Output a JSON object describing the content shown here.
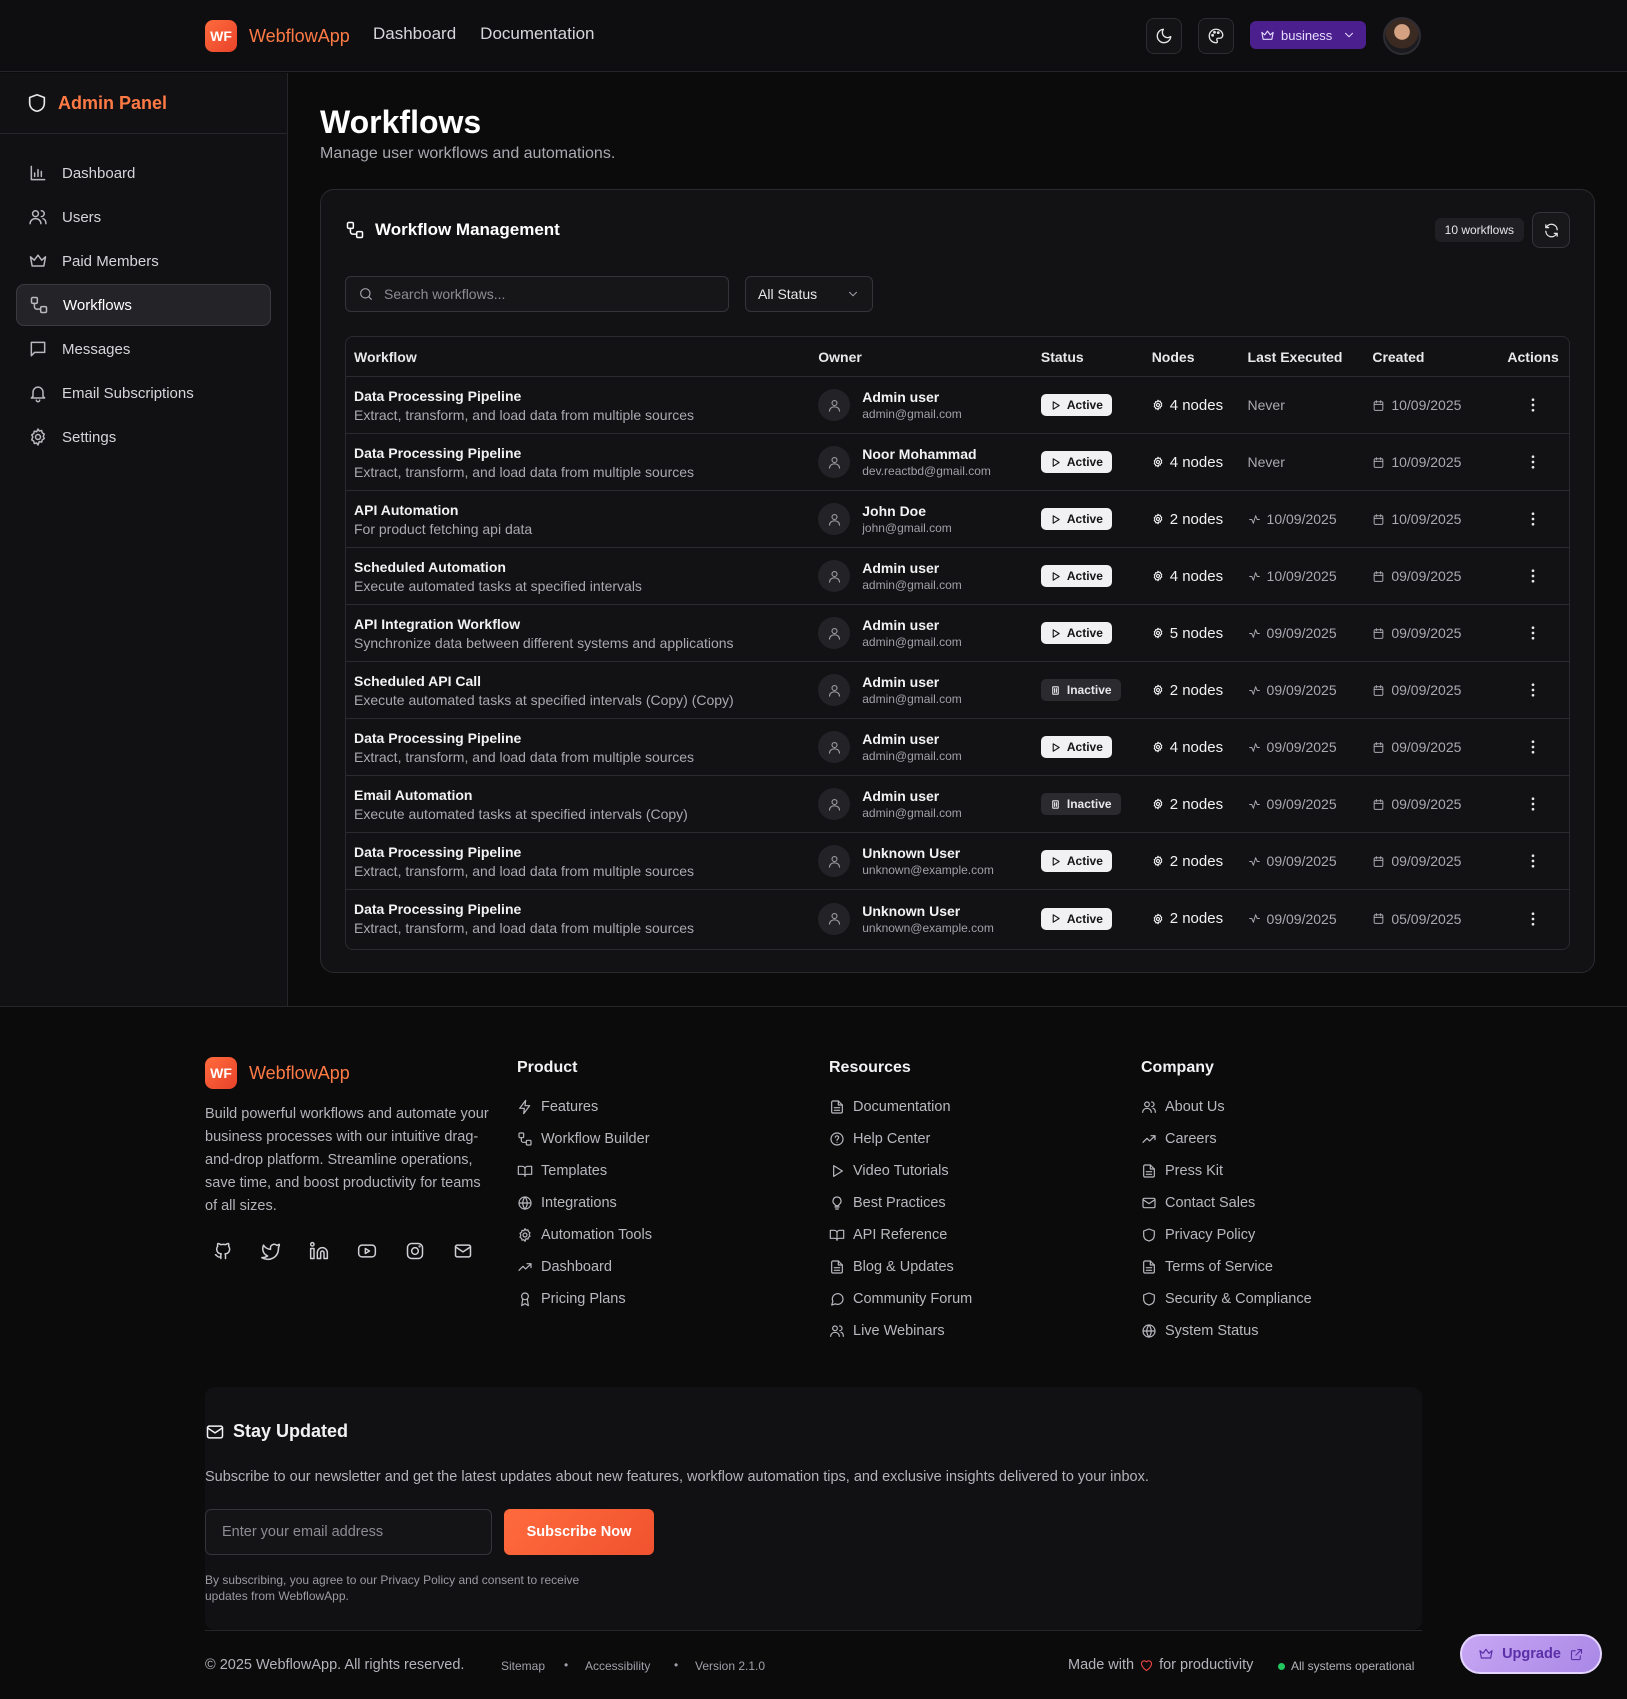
{
  "app": {
    "logo_badge": "WF",
    "name": "WebflowApp",
    "nav": [
      "Dashboard",
      "Documentation"
    ],
    "plan_label": "business"
  },
  "sidebar": {
    "title": "Admin Panel",
    "items": [
      {
        "label": "Dashboard",
        "icon": "bar-chart-icon"
      },
      {
        "label": "Users",
        "icon": "users-icon"
      },
      {
        "label": "Paid Members",
        "icon": "crown-icon"
      },
      {
        "label": "Workflows",
        "icon": "workflow-icon",
        "active": true
      },
      {
        "label": "Messages",
        "icon": "message-icon"
      },
      {
        "label": "Email Subscriptions",
        "icon": "bell-icon"
      },
      {
        "label": "Settings",
        "icon": "gear-icon"
      }
    ]
  },
  "page": {
    "title": "Workflows",
    "subtitle": "Manage user workflows and automations."
  },
  "card": {
    "title": "Workflow Management",
    "count_label": "10 workflows",
    "search_placeholder": "Search workflows...",
    "status_filter": "All Status"
  },
  "table": {
    "columns": [
      "Workflow",
      "Owner",
      "Status",
      "Nodes",
      "Last Executed",
      "Created",
      "Actions"
    ],
    "rows": [
      {
        "name": "Data Processing Pipeline",
        "desc": "Extract, transform, and load data from multiple sources",
        "owner": "Admin user",
        "email": "admin@gmail.com",
        "status": "Active",
        "nodes": "4 nodes",
        "last": "Never",
        "created": "10/09/2025"
      },
      {
        "name": "Data Processing Pipeline",
        "desc": "Extract, transform, and load data from multiple sources",
        "owner": "Noor Mohammad",
        "email": "dev.reactbd@gmail.com",
        "status": "Active",
        "nodes": "4 nodes",
        "last": "Never",
        "created": "10/09/2025"
      },
      {
        "name": "API Automation",
        "desc": "For product fetching api data",
        "owner": "John Doe",
        "email": "john@gmail.com",
        "status": "Active",
        "nodes": "2 nodes",
        "last": "10/09/2025",
        "created": "10/09/2025"
      },
      {
        "name": "Scheduled Automation",
        "desc": "Execute automated tasks at specified intervals",
        "owner": "Admin user",
        "email": "admin@gmail.com",
        "status": "Active",
        "nodes": "4 nodes",
        "last": "10/09/2025",
        "created": "09/09/2025"
      },
      {
        "name": "API Integration Workflow",
        "desc": "Synchronize data between different systems and applications",
        "owner": "Admin user",
        "email": "admin@gmail.com",
        "status": "Active",
        "nodes": "5 nodes",
        "last": "09/09/2025",
        "created": "09/09/2025"
      },
      {
        "name": "Scheduled API Call",
        "desc": "Execute automated tasks at specified intervals (Copy) (Copy)",
        "owner": "Admin user",
        "email": "admin@gmail.com",
        "status": "Inactive",
        "nodes": "2 nodes",
        "last": "09/09/2025",
        "created": "09/09/2025"
      },
      {
        "name": "Data Processing Pipeline",
        "desc": "Extract, transform, and load data from multiple sources",
        "owner": "Admin user",
        "email": "admin@gmail.com",
        "status": "Active",
        "nodes": "4 nodes",
        "last": "09/09/2025",
        "created": "09/09/2025"
      },
      {
        "name": "Email Automation",
        "desc": "Execute automated tasks at specified intervals (Copy)",
        "owner": "Admin user",
        "email": "admin@gmail.com",
        "status": "Inactive",
        "nodes": "2 nodes",
        "last": "09/09/2025",
        "created": "09/09/2025"
      },
      {
        "name": "Data Processing Pipeline",
        "desc": "Extract, transform, and load data from multiple sources",
        "owner": "Unknown User",
        "email": "unknown@example.com",
        "status": "Active",
        "nodes": "2 nodes",
        "last": "09/09/2025",
        "created": "09/09/2025"
      },
      {
        "name": "Data Processing Pipeline",
        "desc": "Extract, transform, and load data from multiple sources",
        "owner": "Unknown User",
        "email": "unknown@example.com",
        "status": "Active",
        "nodes": "2 nodes",
        "last": "09/09/2025",
        "created": "05/09/2025"
      }
    ]
  },
  "footer": {
    "description": "Build powerful workflows and automate your business processes with our intuitive drag-and-drop platform. Streamline operations, save time, and boost productivity for teams of all sizes.",
    "socials": [
      "github-icon",
      "twitter-icon",
      "linkedin-icon",
      "youtube-icon",
      "instagram-icon",
      "mail-icon"
    ],
    "columns": [
      {
        "title": "Product",
        "links": [
          {
            "label": "Features",
            "icon": "zap-icon"
          },
          {
            "label": "Workflow Builder",
            "icon": "workflow-icon"
          },
          {
            "label": "Templates",
            "icon": "book-icon"
          },
          {
            "label": "Integrations",
            "icon": "globe-icon"
          },
          {
            "label": "Automation Tools",
            "icon": "gear-icon"
          },
          {
            "label": "Dashboard",
            "icon": "trending-icon"
          },
          {
            "label": "Pricing Plans",
            "icon": "award-icon"
          }
        ]
      },
      {
        "title": "Resources",
        "links": [
          {
            "label": "Documentation",
            "icon": "file-icon"
          },
          {
            "label": "Help Center",
            "icon": "help-icon"
          },
          {
            "label": "Video Tutorials",
            "icon": "play-icon"
          },
          {
            "label": "Best Practices",
            "icon": "bulb-icon"
          },
          {
            "label": "API Reference",
            "icon": "book-icon"
          },
          {
            "label": "Blog & Updates",
            "icon": "file-icon"
          },
          {
            "label": "Community Forum",
            "icon": "message-icon"
          },
          {
            "label": "Live Webinars",
            "icon": "users-icon"
          }
        ]
      },
      {
        "title": "Company",
        "links": [
          {
            "label": "About Us",
            "icon": "users-icon"
          },
          {
            "label": "Careers",
            "icon": "trending-icon"
          },
          {
            "label": "Press Kit",
            "icon": "file-icon"
          },
          {
            "label": "Contact Sales",
            "icon": "mail-icon"
          },
          {
            "label": "Privacy Policy",
            "icon": "shield-icon"
          },
          {
            "label": "Terms of Service",
            "icon": "file-icon"
          },
          {
            "label": "Security & Compliance",
            "icon": "shield-icon"
          },
          {
            "label": "System Status",
            "icon": "globe-icon"
          }
        ]
      }
    ],
    "newsletter": {
      "title": "Stay Updated",
      "description": "Subscribe to our newsletter and get the latest updates about new features, workflow automation tips, and exclusive insights delivered to your inbox.",
      "email_placeholder": "Enter your email address",
      "button": "Subscribe Now",
      "terms": "By subscribing, you agree to our Privacy Policy and consent to receive updates from WebflowApp."
    },
    "copyright": "© 2025 WebflowApp. All rights reserved.",
    "bottom_links": [
      "Sitemap",
      "Accessibility",
      "Version 2.1.0"
    ],
    "separator": "•",
    "made_before": "Made with",
    "made_after": "for productivity",
    "system_status": "All systems operational"
  },
  "upgrade_label": "Upgrade",
  "colors": {
    "accent": "#ff6b3d",
    "plan": "#4b1f8e",
    "upgrade": "#b897ed",
    "status_ok": "#22c55e"
  }
}
